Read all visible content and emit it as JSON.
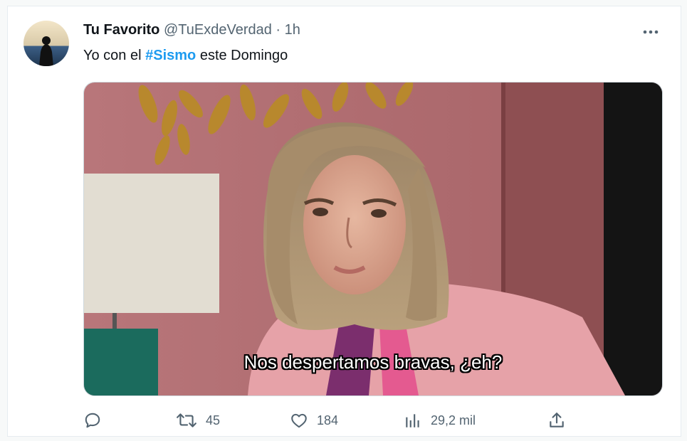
{
  "tweet": {
    "author_name": "Tu Favorito",
    "author_handle": "@TuExdeVerdad",
    "separator": "·",
    "time": "1h",
    "text_before": "Yo con el ",
    "hashtag": "#Sismo",
    "text_after": " este Domingo",
    "media_subtitle": "Nos despertamos bravas, ¿eh?"
  },
  "actions": {
    "reply_count": "",
    "retweet_count": "45",
    "like_count": "184",
    "views_count": "29,2 mil"
  },
  "icons": {
    "more": "more-dots-icon",
    "reply": "reply-icon",
    "retweet": "retweet-icon",
    "like": "heart-icon",
    "views": "views-bar-chart-icon",
    "share": "share-icon"
  },
  "colors": {
    "link": "#1d9bf0",
    "text": "#0f1419",
    "muted": "#536471"
  }
}
